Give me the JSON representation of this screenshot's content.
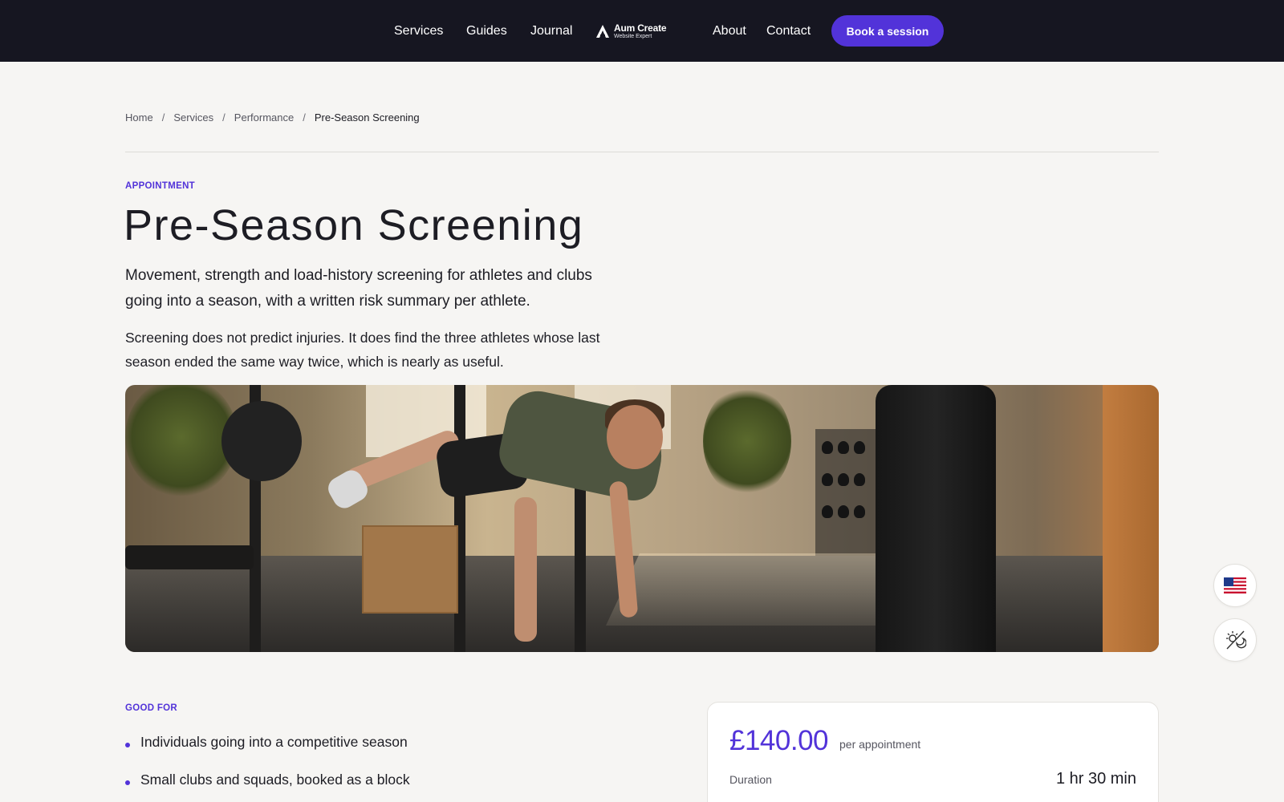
{
  "nav": {
    "links_left": [
      "Services",
      "Guides",
      "Journal"
    ],
    "links_right": [
      "About",
      "Contact"
    ],
    "logo_title": "Aum Create",
    "logo_subtitle": "Website Expert",
    "cta_label": "Book a session"
  },
  "breadcrumb": {
    "items": [
      "Home",
      "Services",
      "Performance"
    ],
    "current": "Pre-Season Screening",
    "separator": "/"
  },
  "hero": {
    "eyebrow": "APPOINTMENT",
    "title": "Pre-Season Screening",
    "lead": "Movement, strength and load-history screening for athletes and clubs going into a season, with a written risk summary per athlete.",
    "body": "Screening does not predict injuries. It does find the three athletes whose last season ended the same way twice, which is nearly as useful.",
    "image_icon": "photo-athlete-screening"
  },
  "good_for": {
    "eyebrow": "GOOD FOR",
    "items": [
      "Individuals going into a competitive season",
      "Small clubs and squads, booked as a block"
    ]
  },
  "price_card": {
    "price": "£140.00",
    "unit": "per appointment",
    "duration_label": "Duration",
    "duration_value": "1 hr 30 min"
  },
  "floating": {
    "language_icon": "us-flag-icon",
    "theme_icon": "theme-toggle-icon"
  },
  "colors": {
    "accent": "#5233d9",
    "nav_bg": "#161621",
    "page_bg": "#f6f5f3"
  }
}
